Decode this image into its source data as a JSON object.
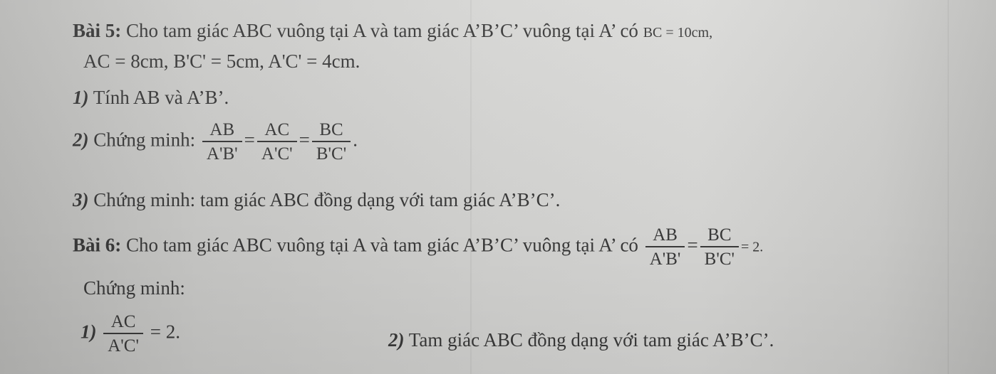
{
  "bai5": {
    "label": "Bài 5:",
    "intro": " Cho tam giác ABC vuông tại A và tam giác A’B’C’ vuông tại A’ có ",
    "bc_given": "BC = 10cm,",
    "givens": "AC = 8cm, B'C' = 5cm, A'C' = 4cm.",
    "q1": {
      "num": "1)",
      "text": " Tính AB và A’B’."
    },
    "q2": {
      "num": "2)",
      "text": " Chứng minh: ",
      "fractions": [
        {
          "num": "AB",
          "den": "A'B'"
        },
        {
          "num": "AC",
          "den": "A'C'"
        },
        {
          "num": "BC",
          "den": "B'C'"
        }
      ],
      "equals": "=",
      "end": "."
    },
    "q3": {
      "num": "3)",
      "text": " Chứng minh: tam giác ABC đồng dạng với tam giác A’B’C’."
    }
  },
  "bai6": {
    "label": "Bài 6:",
    "intro": " Cho tam giác ABC vuông tại A và tam giác A’B’C’ vuông tại A’ có ",
    "fractions": [
      {
        "num": "AB",
        "den": "A'B'"
      },
      {
        "num": "BC",
        "den": "B'C'"
      }
    ],
    "equals": "=",
    "ratio_end": "= 2.",
    "prove_label": "Chứng minh:",
    "q1": {
      "num": "1)",
      "frac": {
        "num": "AC",
        "den": "A'C'"
      },
      "end": " = 2."
    },
    "q2": {
      "num": "2)",
      "text": " Tam giác ABC đồng dạng với tam giác A’B’C’."
    }
  }
}
